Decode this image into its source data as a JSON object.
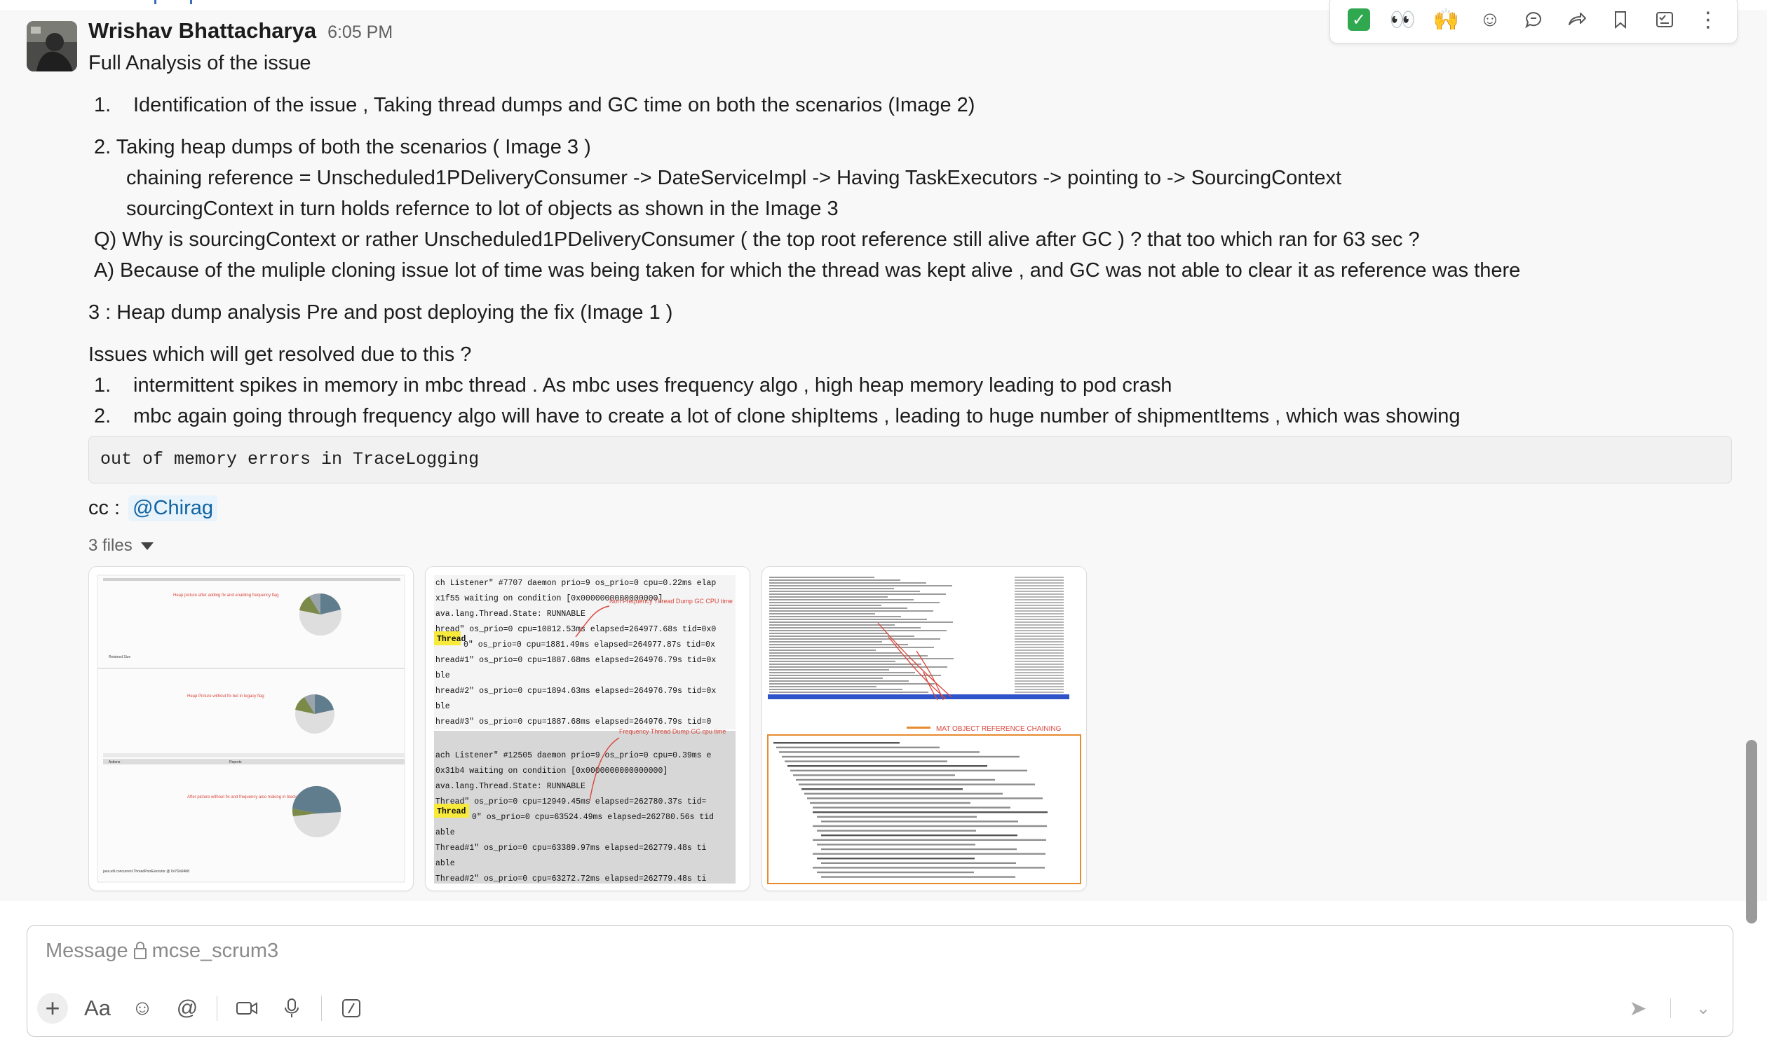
{
  "message": {
    "author": "Wrishav Bhattacharya",
    "time": "6:05 PM",
    "lines": {
      "l1": "Full Analysis of the issue",
      "l2_num": "1.",
      "l2": "Identification of the issue , Taking thread dumps and GC time on both the scenarios (Image 2)",
      "l3": "2.  Taking heap dumps of both the scenarios ( Image 3 )",
      "l4": "chaining reference = Unscheduled1PDeliveryConsumer -> DateServiceImpl -> Having TaskExecutors -> pointing to -> SourcingContext",
      "l5": "sourcingContext in turn holds refernce to lot of objects as shown in the Image 3",
      "l6": "Q) Why is sourcingContext or rather Unscheduled1PDeliveryConsumer ( the top root reference still alive after GC ) ? that too which ran for 63 sec ?",
      "l7": "A) Because of the muliple cloning issue lot of time was being taken for which the thread was kept alive , and GC was not able to clear it as reference was there",
      "l8": "3 : Heap dump analysis Pre and post deploying the fix  (Image 1 )",
      "l9": "Issues which will  get resolved due to this ?",
      "l10_num": "1.",
      "l10": "intermittent spikes in memory in mbc thread . As mbc uses frequency algo , high heap memory leading to pod crash",
      "l11_num": "2.",
      "l11": "mbc again going through frequency algo will have to create a lot of clone shipItems , leading to huge number of shipmentItems , which was showing"
    },
    "code": "out of memory errors in TraceLogging",
    "cc_label": "cc :",
    "mention": "@Chirag",
    "files_label": "3 files"
  },
  "thumbnails": {
    "t1": {
      "caption1": "Heap picture after adding fix and enabling frequency flag",
      "caption2": "Heap Picture without fix but in legacy flag",
      "caption3": "After picture without fix and frequency also making in black objection",
      "footer": "java.util.concurrent.ThreadPoolExecutor @ 0x7f2a94b8"
    },
    "t2": {
      "lines_a": [
        "ch Listener\" #7707 daemon prio=9 os_prio=0 cpu=0.22ms elap",
        "x1f55 waiting on condition  [0x0000000000000000]",
        "ava.lang.Thread.State: RUNNABLE",
        "hread\" os_prio=0 cpu=10812.53ms elapsed=264977.68s tid=0x0",
        "0\" os_prio=0 cpu=1881.49ms elapsed=264977.87s tid=0x",
        "hread#1\" os_prio=0 cpu=1887.68ms elapsed=264976.79s tid=0x",
        "ble",
        "hread#2\" os_prio=0 cpu=1894.63ms elapsed=264976.79s tid=0x",
        "ble",
        "hread#3\" os_prio=0 cpu=1887.68ms elapsed=264976.79s tid=0"
      ],
      "lines_b": [
        "ach Listener\" #12505 daemon prio=9 os_prio=0 cpu=0.39ms e",
        "0x31b4 waiting on condition  [0x0000000000000000]",
        "ava.lang.Thread.State: RUNNABLE",
        "Thread\" os_prio=0 cpu=12949.45ms elapsed=262780.37s tid=",
        "0\" os_prio=0 cpu=63524.49ms elapsed=262780.56s tid",
        "able",
        "Thread#1\" os_prio=0 cpu=63389.97ms elapsed=262779.48s ti",
        "able",
        "Thread#2\" os_prio=0 cpu=63272.72ms elapsed=262779.48s ti"
      ],
      "highlight": "Thread",
      "annot_a": "Non Frequency Thread Dump GC CPU time",
      "annot_b": "Frequency Thread Dump GC cpu time"
    },
    "t3": {
      "annotation": "MAT OBJECT REFERENCE CHAINING"
    }
  },
  "actions": {
    "check": "✓",
    "eyes": "👀",
    "raised_hands": "🙌",
    "add_reaction": "☺",
    "reply": "💬",
    "forward": "↪",
    "bookmark": "🔖",
    "more": "⋮"
  },
  "composer": {
    "placeholder": "Message",
    "channel": "mcse_scrum3",
    "format_label": "Aa",
    "mention_symbol": "@",
    "emoji": "☺",
    "slash": "/",
    "send": "➤",
    "chevron": "⌄"
  },
  "colors": {
    "mention_bg": "#e8f3fb",
    "mention_text": "#1264a3",
    "check_bg": "#2fa84f",
    "annotation_red": "#d9473d",
    "selection_blue": "#2f54c9"
  }
}
